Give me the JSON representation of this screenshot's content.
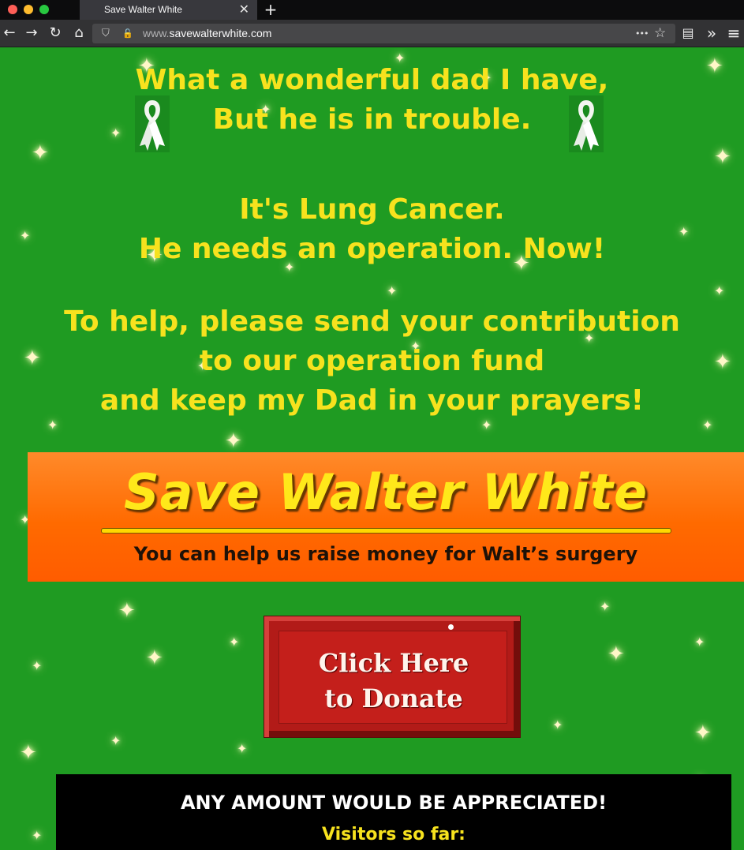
{
  "browser": {
    "tab_title": "Save Walter White",
    "tab_close": "✕",
    "new_tab": "+",
    "url_prefix": "www.",
    "url_domain": "savewalterwhite.com",
    "icons": {
      "back": "back-arrow-icon",
      "forward": "forward-arrow-icon",
      "reload": "reload-icon",
      "home": "home-icon",
      "shield": "tracking-shield-icon",
      "insecure": "insecure-lock-icon",
      "more": "page-actions-icon",
      "bookmark": "bookmark-star-icon",
      "clipboard": "reader-clipboard-icon",
      "overflow": "overflow-chevrons-icon",
      "menu": "hamburger-menu-icon"
    },
    "glyphs": {
      "back": "←",
      "forward": "→",
      "reload": "↻",
      "home": "⌂",
      "shield": "⛉",
      "insecure": "🔓",
      "more": "•••",
      "bookmark": "☆",
      "clipboard": "▤",
      "overflow": "»",
      "menu": "≡"
    },
    "colors": {
      "chrome_bg": "#0c0c0d",
      "tab_bg": "#38383d",
      "nav_bg": "#323234",
      "urlbar_bg": "#474749"
    }
  },
  "page": {
    "background_color": "#1f9b22",
    "text_color": "#f7e21e",
    "intro_line1": "What a wonderful dad I have,",
    "intro_line2": "But he is in trouble.",
    "cancer_line1": "It's Lung Cancer.",
    "cancer_line2": "He needs an operation. Now!",
    "help_line1": "To help, please send your contribution",
    "help_line2": "to our operation fund",
    "help_line3": "and keep my Dad in your prayers!",
    "ribbon_icon": "white-awareness-ribbon-icon",
    "sparkle_glyph": "✦"
  },
  "banner": {
    "title": "Save Walter White",
    "subtitle": "You can help us raise money for Walt’s surgery",
    "colors": {
      "title": "#ffe81a",
      "background": "#ff6a00"
    }
  },
  "donate_button": {
    "line1": "Click Here",
    "line2": "to Donate",
    "color": "#b21b18"
  },
  "footer": {
    "appreciation": "ANY AMOUNT WOULD BE APPRECIATED!",
    "visitors_label": "Visitors so far:"
  }
}
